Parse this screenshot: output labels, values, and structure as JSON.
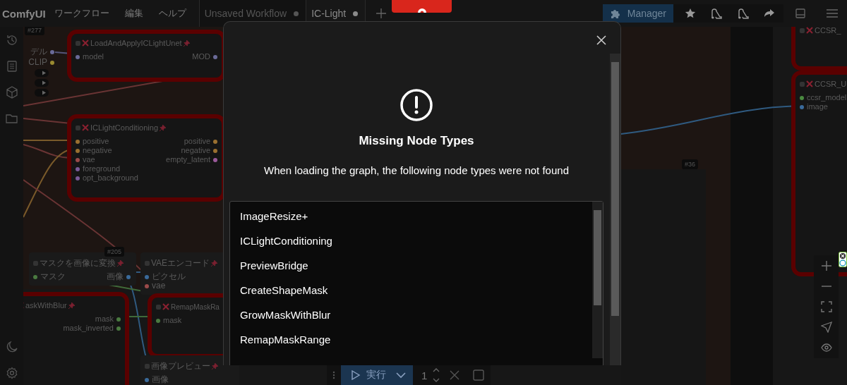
{
  "menu_bar": {
    "logo": "ComfyUI",
    "menus": [
      {
        "label": "ワークフロー"
      },
      {
        "label": "編集"
      },
      {
        "label": "ヘルプ"
      }
    ]
  },
  "tabs": [
    {
      "label": "Unsaved Workflow",
      "selected": false
    },
    {
      "label": "IC-Light",
      "selected": true
    }
  ],
  "toolbar": {
    "manager_label": "Manager"
  },
  "canvas": {
    "badges": [
      "#277",
      "#205",
      "#36"
    ],
    "fragment": {
      "outputs": [
        {
          "name": "デル",
          "color": "#6a6a98"
        },
        {
          "name": "CLIP",
          "color": "#9a8a30"
        }
      ]
    },
    "nodes": [
      {
        "kind": "missing",
        "title": "LoadAndApplyICLightUnet",
        "pinned": true,
        "inputs": [
          {
            "name": "model",
            "color": "#6a6a98"
          }
        ],
        "outputs": [
          {
            "name": "MOD",
            "color": "#6a6a98"
          }
        ]
      },
      {
        "kind": "missing",
        "title": "ICLightConditioning",
        "pinned": true,
        "inputs": [
          {
            "name": "positive",
            "color": "#9a7030"
          },
          {
            "name": "negative",
            "color": "#9a7030"
          },
          {
            "name": "vae",
            "color": "#9a4a4a"
          },
          {
            "name": "foreground",
            "color": "#7a5a98"
          },
          {
            "name": "opt_background",
            "color": "#7a5a98"
          }
        ],
        "outputs": [
          {
            "name": "positive",
            "color": "#9a7030"
          },
          {
            "name": "negative",
            "color": "#9a7030"
          },
          {
            "name": "empty_latent",
            "color": "#9a5a9a"
          }
        ]
      },
      {
        "kind": "normal",
        "title": "マスクを画像に変換",
        "pinned": true,
        "inputs": [
          {
            "name": "マスク",
            "color": "#4a7a40"
          }
        ],
        "outputs": [
          {
            "name": "画像",
            "color": "#3a6a9a"
          }
        ]
      },
      {
        "kind": "normal",
        "title": "VAEエンコード",
        "pinned": true,
        "inputs": [
          {
            "name": "ピクセル",
            "color": "#3a6a9a"
          },
          {
            "name": "vae",
            "color": "#9a4a4a"
          }
        ]
      },
      {
        "kind": "missing",
        "title": "askWithBlur",
        "pinned": true,
        "outputs": [
          {
            "name": "mask",
            "color": "#4a7a40"
          },
          {
            "name": "mask_inverted",
            "color": "#4a7a40"
          }
        ]
      },
      {
        "kind": "missing",
        "title": "RemapMaskRa",
        "inputs": [
          {
            "name": "mask",
            "color": "#4a7a40"
          }
        ]
      },
      {
        "kind": "normal",
        "title": "画像プレビュー",
        "pinned": true,
        "inputs": [
          {
            "name": "画像",
            "color": "#3a6a9a"
          }
        ]
      },
      {
        "kind": "missing",
        "title": "CCSR_"
      },
      {
        "kind": "missing",
        "title": "CCSR_U",
        "inputs": [
          {
            "name": "ccsr_model",
            "color": "#4a8a40"
          },
          {
            "name": "image",
            "color": "#3a6a9a"
          }
        ]
      }
    ]
  },
  "dialog": {
    "title": "Missing Node Types",
    "message": "When loading the graph, the following node types were not found",
    "missing_types": [
      "ImageResize+",
      "ICLightConditioning",
      "PreviewBridge",
      "CreateShapeMask",
      "GrowMaskWithBlur",
      "RemapMaskRange"
    ]
  },
  "run_bar": {
    "label": "実行",
    "count": "1"
  }
}
